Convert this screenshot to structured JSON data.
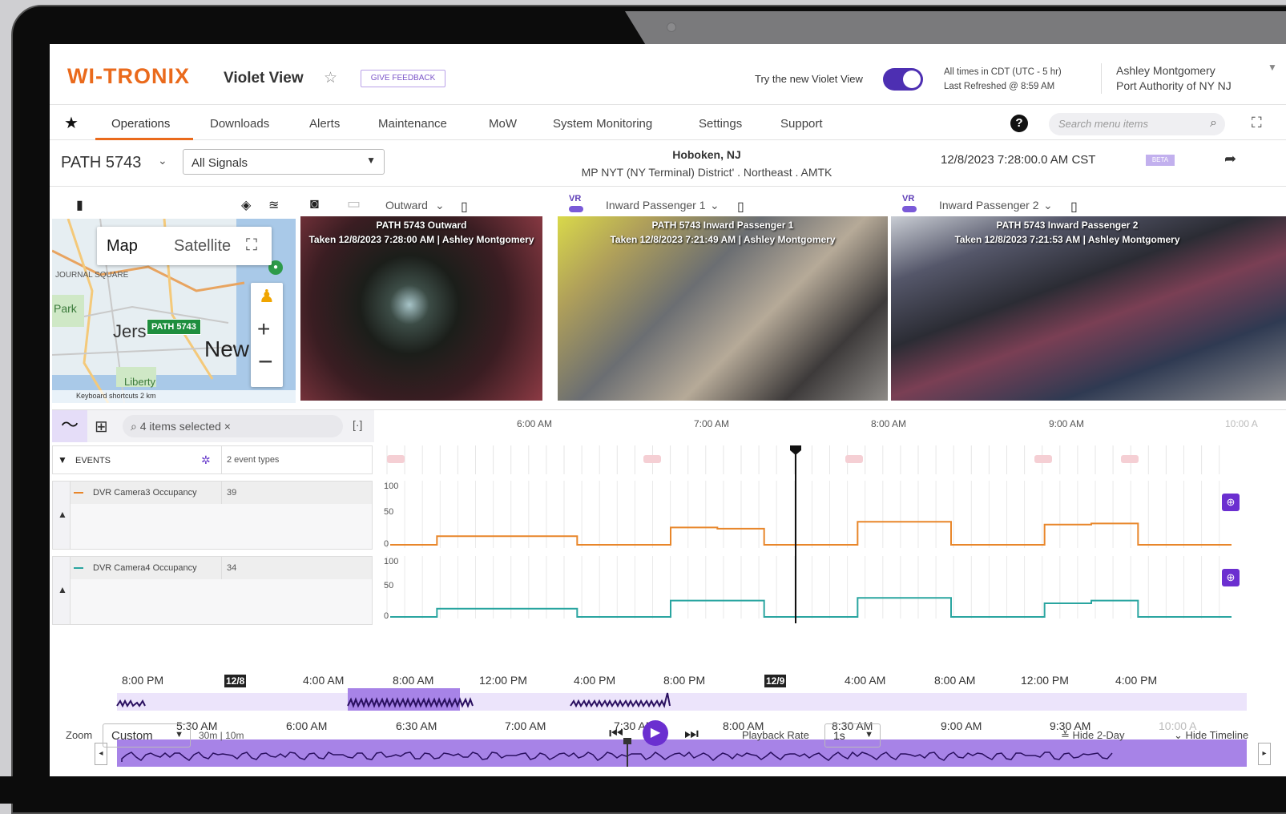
{
  "header": {
    "logo": "WI-TRONIX",
    "app_title": "Violet View",
    "feedback": "GIVE FEEDBACK",
    "try_new": "Try the new Violet View",
    "times_line1": "All times in CDT (UTC - 5 hr)",
    "times_line2": "Last Refreshed @ 8:59 AM",
    "user_name": "Ashley Montgomery",
    "user_org": "Port Authority of NY NJ"
  },
  "nav": {
    "items": [
      "Operations",
      "Downloads",
      "Alerts",
      "Maintenance",
      "MoW",
      "System Monitoring",
      "Settings",
      "Support"
    ],
    "search_placeholder": "Search menu items"
  },
  "subheader": {
    "vehicle": "PATH 5743",
    "signals": "All Signals",
    "location": "Hoboken, NJ",
    "district": "MP NYT (NY Terminal) District' . Northeast . AMTK",
    "datetime": "12/8/2023 7:28:00.0 AM CST",
    "beta": "BETA"
  },
  "map": {
    "map_btn": "Map",
    "satellite_btn": "Satellite",
    "pin_label": "PATH 5743",
    "city_label": "New",
    "jersey_label": "Jers",
    "square_label": "JOURNAL SQUARE",
    "park_label": "Park",
    "liberty_label": "Liberty",
    "kbd": "Keyboard shortcuts   2 km"
  },
  "cameras": [
    {
      "select": "Outward",
      "title": "PATH 5743 Outward",
      "taken": "Taken 12/8/2023 7:28:00 AM | Ashley Montgomery"
    },
    {
      "select": "Inward Passenger 1",
      "title": "PATH 5743 Inward Passenger 1",
      "taken": "Taken 12/8/2023 7:21:49 AM | Ashley Montgomery"
    },
    {
      "select": "Inward Passenger 2",
      "title": "PATH 5743 Inward Passenger 2",
      "taken": "Taken 12/8/2023 7:21:53 AM | Ashley Montgomery"
    }
  ],
  "vr_label": "VR",
  "chart": {
    "items_selected": "4 items selected",
    "axis_labels": [
      "6:00 AM",
      "7:00 AM",
      "8:00 AM",
      "9:00 AM",
      "10:00 A"
    ],
    "events_label": "EVENTS",
    "event_types": "2 event types",
    "signals": [
      {
        "name": "DVR Camera3 Occupancy",
        "value": "39",
        "color": "#e8862a"
      },
      {
        "name": "DVR Camera4 Occupancy",
        "value": "34",
        "color": "#2aa5a0"
      }
    ],
    "y_ticks": [
      "100",
      "50",
      "0"
    ]
  },
  "chart_data": {
    "type": "line",
    "x": [
      "5:30",
      "5:45",
      "6:00",
      "6:15",
      "6:30",
      "6:45",
      "7:00",
      "7:15",
      "7:30",
      "7:45",
      "8:00",
      "8:15",
      "8:30",
      "8:45",
      "9:00",
      "9:15",
      "9:30",
      "9:45",
      "10:00"
    ],
    "series": [
      {
        "name": "DVR Camera3 Occupancy",
        "values": [
          0,
          15,
          15,
          15,
          0,
          0,
          30,
          28,
          0,
          0,
          40,
          40,
          0,
          0,
          35,
          37,
          0,
          0,
          0
        ]
      },
      {
        "name": "DVR Camera4 Occupancy",
        "values": [
          0,
          15,
          15,
          15,
          0,
          0,
          30,
          30,
          0,
          0,
          35,
          35,
          0,
          0,
          25,
          30,
          0,
          0,
          0
        ]
      }
    ],
    "ylim": [
      0,
      100
    ]
  },
  "timeline": {
    "top_labels": [
      "8:00 PM",
      "12/8",
      "4:00 AM",
      "8:00 AM",
      "12:00 PM",
      "4:00 PM",
      "8:00 PM",
      "12/9",
      "4:00 AM",
      "8:00 AM",
      "12:00 PM",
      "4:00 PM"
    ],
    "bottom_labels": [
      "5:30 AM",
      "6:00 AM",
      "6:30 AM",
      "7:00 AM",
      "7:30 AM",
      "8:00 AM",
      "8:30 AM",
      "9:00 AM",
      "9:30 AM",
      "10:00 A"
    ]
  },
  "controls": {
    "zoom_label": "Zoom",
    "zoom_value": "Custom",
    "range": "30m | 10m",
    "rate_label": "Playback Rate",
    "rate_value": "1s",
    "hide_2day": "Hide 2-Day",
    "hide_timeline": "Hide Timeline"
  }
}
